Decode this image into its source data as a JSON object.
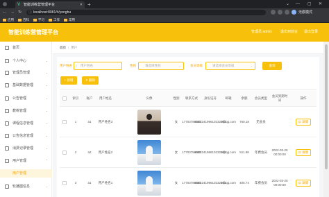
{
  "browser": {
    "tab_title": "智能训练营管理平台",
    "url": "localhost:8081/#/yonghu",
    "profile_label": "无痕模式",
    "bookmarks": [
      "应用",
      "百科",
      "学习",
      "工作",
      "常用"
    ]
  },
  "header": {
    "title": "智能训练营管理平台",
    "user_label": "管理员 admin",
    "link_front": "退出到前台",
    "link_logout": "退出登录"
  },
  "sidebar": {
    "items": [
      {
        "label": "首页",
        "icon": "home-icon"
      },
      {
        "label": "个人中心",
        "icon": "user-icon"
      },
      {
        "label": "管理员管理",
        "icon": "admin-icon"
      },
      {
        "label": "基础数据管理",
        "icon": "database-icon"
      },
      {
        "label": "公告管理",
        "icon": "notice-icon"
      },
      {
        "label": "教练管理",
        "icon": "coach-icon"
      },
      {
        "label": "课程信息管理",
        "icon": "course-icon"
      },
      {
        "label": "公告信息管理",
        "icon": "info-icon"
      },
      {
        "label": "消费记录管理",
        "icon": "record-icon"
      },
      {
        "label": "用户管理",
        "icon": "users-icon"
      }
    ],
    "active_sub": "用户管理",
    "after_items": [
      {
        "label": "轮播图信息",
        "icon": "carousel-icon"
      }
    ]
  },
  "breadcrumb": {
    "home": "首页",
    "current": "用户"
  },
  "search": {
    "name_label": "用户姓名",
    "name_placeholder": "用户姓名",
    "gender_label": "性别",
    "gender_placeholder": "请选择性别",
    "level_label": "会员等级",
    "level_placeholder": "请选择会员等级",
    "query_button": "查询"
  },
  "actions": {
    "add": "新增",
    "delete": "删除"
  },
  "table": {
    "headers": [
      "索引",
      "账户",
      "用户姓名",
      "头像",
      "性别",
      "联系方式",
      "身份证号",
      "邮箱",
      "余额",
      "会员类型",
      "会员到期时间",
      "操作"
    ],
    "rows": [
      {
        "index": "1",
        "account": "a1",
        "name": "用户姓名3",
        "avatar": "person",
        "gender": "女",
        "phone": "17703786903",
        "id_card": "410224199610232003",
        "email": "3@qq.com",
        "balance": "760.18",
        "member_type": "无会员",
        "expire": "",
        "action": "详情"
      },
      {
        "index": "2",
        "account": "a2",
        "name": "用户姓名2",
        "avatar": "sky",
        "gender": "女",
        "phone": "17703786902",
        "id_card": "410224199610232002",
        "email": "2@qq.com",
        "balance": "511.98",
        "member_type": "年费会员",
        "expire": "2022-03-20 00:00:00",
        "action": "详情"
      },
      {
        "index": "3",
        "account": "a1",
        "name": "用户姓名1",
        "avatar": "sky",
        "gender": "女",
        "phone": "17703786901",
        "id_card": "410224199610232001",
        "email": "1@qq.com",
        "balance": "405.74",
        "member_type": "年费会员",
        "expire": "2022-03-20 00:00:00",
        "action": "详情"
      }
    ]
  },
  "colors": {
    "accent": "#f7c10b",
    "accent_text": "#f7a600",
    "chrome_dark": "#202124"
  }
}
